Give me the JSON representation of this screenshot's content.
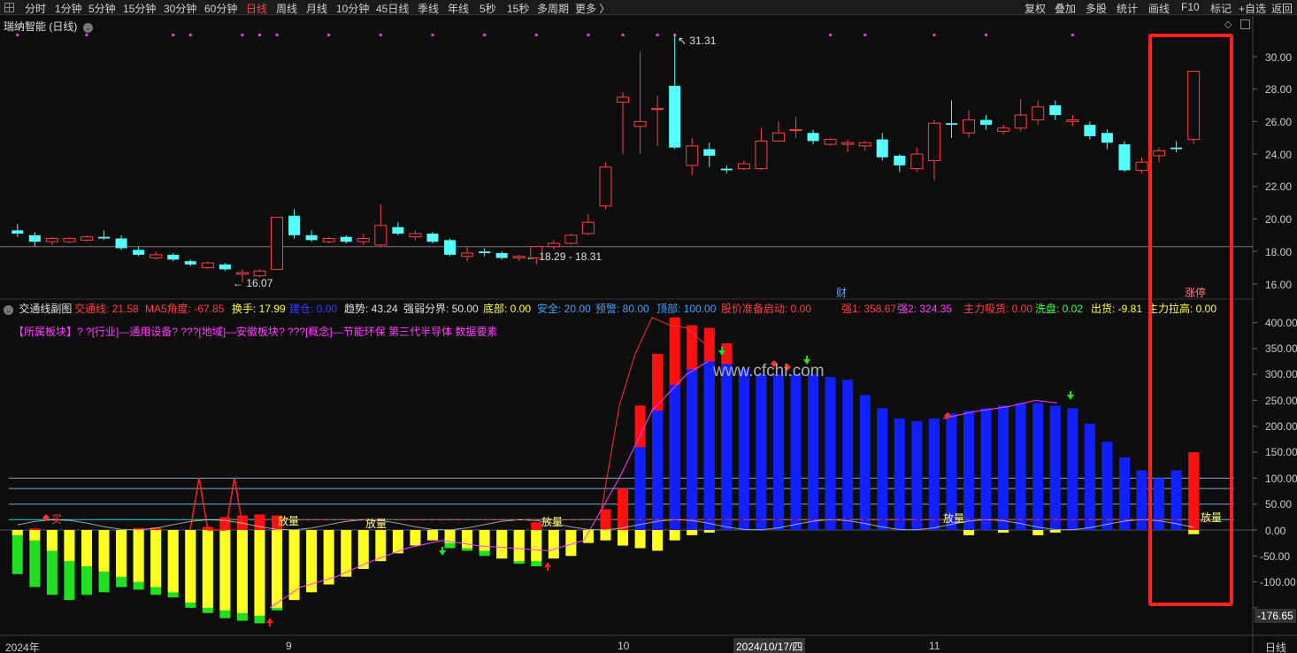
{
  "toolbar": {
    "items": [
      "分时",
      "1分钟",
      "5分钟",
      "15分钟",
      "30分钟",
      "60分钟",
      "日线",
      "周线",
      "月线",
      "10分钟",
      "45日线",
      "季线",
      "年线",
      "5秒",
      "15秒",
      "多周期",
      "更多 〉"
    ],
    "active_index": 6,
    "right_items": [
      "复权",
      "叠加",
      "多股",
      "统计",
      "画线",
      "F10",
      "标记",
      "+自选",
      "返回"
    ]
  },
  "main_chart": {
    "title": "瑞纳智能 (日线)",
    "high_label": "31.31",
    "low_label": "16.07",
    "range_label": "18.29 - 18.31",
    "cai_label": "财",
    "zhangting_label": "涨停",
    "y_axis": [
      "30.00",
      "28.00",
      "26.00",
      "24.00",
      "22.00",
      "20.00",
      "18.00",
      "16.00"
    ],
    "up_color": "#ff4040",
    "down_color": "#54ffff"
  },
  "indicator": {
    "name": "交通线副图",
    "values": [
      {
        "text": "交通线: 21.58",
        "color": "#ff4040"
      },
      {
        "text": "MA5角度: -67.85",
        "color": "#ff4040"
      },
      {
        "text": "换手: 17.99",
        "color": "#ffff40"
      },
      {
        "text": "建仓: 0.00",
        "color": "#3040ff"
      },
      {
        "text": "趋势: 43.24",
        "color": "#e0e0e0"
      },
      {
        "text": "强弱分界: 50.00",
        "color": "#e0e0e0"
      },
      {
        "text": "底部: 0.00",
        "color": "#ffff40"
      },
      {
        "text": "安全: 20.00",
        "color": "#40a0ff"
      },
      {
        "text": "预警: 80.00",
        "color": "#40a0ff"
      },
      {
        "text": "顶部: 100.00",
        "color": "#40a0ff"
      },
      {
        "text": "股价准备启动: 0.00",
        "color": "#ff4040"
      },
      {
        "text": "强1: 358.67",
        "color": "#ff4040"
      },
      {
        "text": "强2: 324.35",
        "color": "#ff40ff"
      },
      {
        "text": "主力吸货: 0.00",
        "color": "#ff4040"
      },
      {
        "text": "洗盘: 0.02",
        "color": "#40ff40"
      },
      {
        "text": "出货: -9.81",
        "color": "#ffff40"
      },
      {
        "text": "主力拉高: 0.00",
        "color": "#ffff40"
      }
    ],
    "sector_line": "【所属板块】? ?[行业]—通用设备? ???[地域]—安徽板块? ???[概念]—节能环保 第三代半导体 数据要素",
    "y_axis": [
      "400.00",
      "350.00",
      "300.00",
      "250.00",
      "200.00",
      "150.00",
      "100.00",
      "50.00",
      "0.00",
      "-50.00",
      "-100.00",
      "-150.00"
    ],
    "current_value": "-176.65",
    "watermark": "www.cfchi.com",
    "fangliang_label": "放量",
    "mai_label": "买"
  },
  "x_axis": {
    "labels": [
      "2024年",
      "9",
      "10",
      "2024/10/17/四",
      "11"
    ],
    "period": "日线"
  },
  "candles": [
    {
      "o": 19.3,
      "c": 19.1,
      "h": 19.7,
      "l": 18.9
    },
    {
      "o": 19.0,
      "c": 18.6,
      "h": 19.2,
      "l": 18.3
    },
    {
      "o": 18.6,
      "c": 18.8,
      "h": 18.9,
      "l": 18.4
    },
    {
      "o": 18.6,
      "c": 18.8,
      "h": 18.9,
      "l": 18.5
    },
    {
      "o": 18.7,
      "c": 18.9,
      "h": 19.0,
      "l": 18.6
    },
    {
      "o": 18.9,
      "c": 18.8,
      "h": 19.3,
      "l": 18.7
    },
    {
      "o": 18.8,
      "c": 18.2,
      "h": 19.0,
      "l": 18.1
    },
    {
      "o": 18.1,
      "c": 17.8,
      "h": 18.3,
      "l": 17.7
    },
    {
      "o": 17.6,
      "c": 17.8,
      "h": 18.0,
      "l": 17.5
    },
    {
      "o": 17.8,
      "c": 17.5,
      "h": 17.9,
      "l": 17.4
    },
    {
      "o": 17.4,
      "c": 17.2,
      "h": 17.5,
      "l": 17.1
    },
    {
      "o": 17.0,
      "c": 17.3,
      "h": 17.4,
      "l": 16.9
    },
    {
      "o": 17.2,
      "c": 16.9,
      "h": 17.3,
      "l": 16.8
    },
    {
      "o": 16.6,
      "c": 16.7,
      "h": 16.9,
      "l": 16.1
    },
    {
      "o": 16.5,
      "c": 16.8,
      "h": 16.9,
      "l": 16.4
    },
    {
      "o": 16.9,
      "c": 20.1,
      "h": 20.1,
      "l": 16.9
    },
    {
      "o": 20.2,
      "c": 19.0,
      "h": 20.6,
      "l": 18.8
    },
    {
      "o": 19.0,
      "c": 18.7,
      "h": 19.3,
      "l": 18.6
    },
    {
      "o": 18.6,
      "c": 18.8,
      "h": 18.9,
      "l": 18.5
    },
    {
      "o": 18.9,
      "c": 18.6,
      "h": 19.0,
      "l": 18.5
    },
    {
      "o": 18.6,
      "c": 18.8,
      "h": 19.1,
      "l": 18.4
    },
    {
      "o": 18.4,
      "c": 19.6,
      "h": 20.9,
      "l": 18.3
    },
    {
      "o": 19.5,
      "c": 19.1,
      "h": 19.8,
      "l": 19.0
    },
    {
      "o": 18.9,
      "c": 19.1,
      "h": 19.3,
      "l": 18.7
    },
    {
      "o": 19.1,
      "c": 18.6,
      "h": 19.2,
      "l": 18.5
    },
    {
      "o": 18.7,
      "c": 17.8,
      "h": 18.8,
      "l": 17.7
    },
    {
      "o": 17.7,
      "c": 17.9,
      "h": 18.3,
      "l": 17.4
    },
    {
      "o": 18.0,
      "c": 17.9,
      "h": 18.2,
      "l": 17.7
    },
    {
      "o": 17.9,
      "c": 17.6,
      "h": 18.0,
      "l": 17.5
    },
    {
      "o": 17.6,
      "c": 17.7,
      "h": 17.8,
      "l": 17.4
    },
    {
      "o": 17.6,
      "c": 18.3,
      "h": 18.3,
      "l": 17.2
    },
    {
      "o": 18.3,
      "c": 18.5,
      "h": 18.7,
      "l": 18.1
    },
    {
      "o": 18.5,
      "c": 19.0,
      "h": 19.1,
      "l": 18.4
    },
    {
      "o": 19.1,
      "c": 19.8,
      "h": 20.3,
      "l": 19.0
    },
    {
      "o": 20.8,
      "c": 23.2,
      "h": 23.5,
      "l": 20.6
    },
    {
      "o": 27.2,
      "c": 27.5,
      "h": 27.8,
      "l": 24.0
    },
    {
      "o": 25.7,
      "c": 26.0,
      "h": 30.3,
      "l": 24.0
    },
    {
      "o": 26.8,
      "c": 26.8,
      "h": 27.6,
      "l": 24.5
    },
    {
      "o": 28.2,
      "c": 24.4,
      "h": 31.31,
      "l": 24.3
    },
    {
      "o": 23.3,
      "c": 24.5,
      "h": 25.0,
      "l": 22.7
    },
    {
      "o": 24.3,
      "c": 23.9,
      "h": 24.7,
      "l": 23.2
    },
    {
      "o": 23.1,
      "c": 23.0,
      "h": 23.3,
      "l": 22.8
    },
    {
      "o": 23.1,
      "c": 23.4,
      "h": 23.6,
      "l": 23.0
    },
    {
      "o": 23.1,
      "c": 24.8,
      "h": 25.6,
      "l": 23.0
    },
    {
      "o": 24.8,
      "c": 25.3,
      "h": 26.0,
      "l": 24.9
    },
    {
      "o": 25.5,
      "c": 25.5,
      "h": 26.3,
      "l": 25.0
    },
    {
      "o": 25.3,
      "c": 24.8,
      "h": 25.5,
      "l": 24.6
    },
    {
      "o": 24.6,
      "c": 24.9,
      "h": 25.0,
      "l": 24.5
    },
    {
      "o": 24.6,
      "c": 24.7,
      "h": 24.9,
      "l": 24.1
    },
    {
      "o": 24.5,
      "c": 24.7,
      "h": 24.8,
      "l": 24.2
    },
    {
      "o": 24.9,
      "c": 23.8,
      "h": 25.3,
      "l": 23.6
    },
    {
      "o": 23.9,
      "c": 23.3,
      "h": 24.0,
      "l": 22.9
    },
    {
      "o": 23.1,
      "c": 24.0,
      "h": 24.4,
      "l": 22.9
    },
    {
      "o": 23.6,
      "c": 25.9,
      "h": 26.1,
      "l": 22.4
    },
    {
      "o": 25.9,
      "c": 25.8,
      "h": 27.3,
      "l": 25.0
    },
    {
      "o": 25.3,
      "c": 26.1,
      "h": 26.7,
      "l": 25.0
    },
    {
      "o": 26.1,
      "c": 25.8,
      "h": 26.4,
      "l": 25.5
    },
    {
      "o": 25.4,
      "c": 25.6,
      "h": 25.8,
      "l": 25.2
    },
    {
      "o": 25.6,
      "c": 26.4,
      "h": 27.4,
      "l": 25.4
    },
    {
      "o": 26.1,
      "c": 26.9,
      "h": 27.3,
      "l": 25.8
    },
    {
      "o": 27.0,
      "c": 26.4,
      "h": 27.3,
      "l": 26.1
    },
    {
      "o": 26.0,
      "c": 26.1,
      "h": 26.4,
      "l": 25.7
    },
    {
      "o": 25.8,
      "c": 25.1,
      "h": 26.0,
      "l": 24.9
    },
    {
      "o": 25.3,
      "c": 24.7,
      "h": 25.5,
      "l": 24.3
    },
    {
      "o": 24.6,
      "c": 23.0,
      "h": 24.8,
      "l": 22.9
    },
    {
      "o": 23.0,
      "c": 23.5,
      "h": 23.8,
      "l": 22.8
    },
    {
      "o": 23.9,
      "c": 24.2,
      "h": 24.4,
      "l": 23.5
    },
    {
      "o": 24.4,
      "c": 24.3,
      "h": 24.8,
      "l": 24.1
    },
    {
      "o": 24.9,
      "c": 29.1,
      "h": 29.1,
      "l": 24.6
    }
  ],
  "bars_pos": [
    0,
    3,
    0,
    0,
    0,
    0,
    0,
    4,
    5,
    0,
    0,
    6,
    25,
    28,
    30,
    28,
    0,
    0,
    0,
    0,
    0,
    0,
    0,
    0,
    0,
    0,
    0,
    0,
    0,
    0,
    15,
    0,
    0,
    0,
    40,
    80,
    240,
    340,
    410,
    395,
    390,
    360,
    0,
    0,
    0,
    0,
    0,
    0,
    0,
    0,
    0,
    0,
    0,
    0,
    0,
    0,
    0,
    0,
    0,
    0,
    0,
    0,
    0,
    0,
    0,
    0,
    0,
    0,
    150
  ],
  "bars_blue": [
    0,
    0,
    0,
    0,
    0,
    0,
    0,
    0,
    0,
    0,
    0,
    0,
    0,
    0,
    0,
    0,
    0,
    0,
    0,
    0,
    0,
    0,
    0,
    0,
    0,
    0,
    0,
    0,
    0,
    0,
    0,
    0,
    0,
    0,
    0,
    0,
    160,
    230,
    280,
    310,
    325,
    320,
    310,
    300,
    300,
    300,
    300,
    295,
    290,
    260,
    235,
    215,
    210,
    215,
    225,
    230,
    235,
    240,
    245,
    245,
    240,
    235,
    205,
    170,
    140,
    115,
    100,
    115
  ],
  "bars_neg_yellow": [
    -10,
    -20,
    -40,
    -60,
    -70,
    -80,
    -90,
    -100,
    -110,
    -120,
    -140,
    -150,
    -155,
    -160,
    -165,
    -150,
    -135,
    -120,
    -105,
    -90,
    -75,
    -60,
    -45,
    -30,
    -20,
    -25,
    -35,
    -40,
    -55,
    -60,
    -60,
    -55,
    -50,
    -25,
    -20,
    -30,
    -35,
    -40,
    -20,
    -10,
    -5,
    0,
    0,
    0,
    0,
    0,
    0,
    0,
    0,
    0,
    0,
    0,
    0,
    0,
    0,
    -10,
    0,
    -5,
    0,
    -10,
    -5,
    0,
    0,
    0,
    0,
    0,
    0,
    0,
    -8
  ],
  "bars_neg_green": [
    -85,
    -110,
    -125,
    -135,
    -125,
    -120,
    -110,
    -115,
    -125,
    -130,
    -150,
    -160,
    -170,
    -175,
    -180,
    -155,
    0,
    0,
    0,
    0,
    0,
    0,
    0,
    0,
    0,
    -35,
    -40,
    -50,
    -55,
    -65,
    -70,
    0,
    0,
    0,
    0,
    0,
    0,
    0,
    0,
    0,
    0,
    0,
    0,
    0,
    0,
    0,
    0,
    0,
    0,
    0,
    0,
    0,
    0,
    0,
    0,
    0,
    0,
    0,
    0,
    0,
    0,
    0,
    0,
    0,
    0,
    0,
    0,
    0,
    0
  ]
}
